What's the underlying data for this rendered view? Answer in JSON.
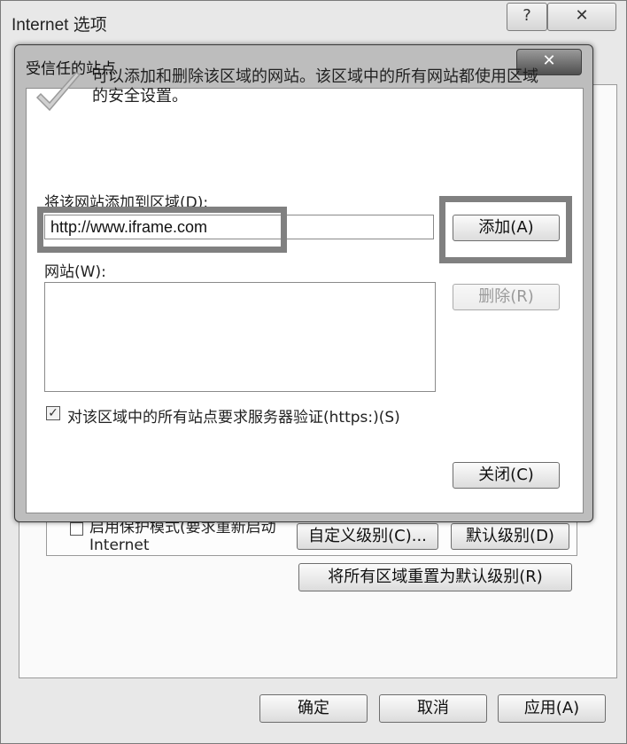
{
  "outer_window": {
    "title": "Internet 选项",
    "help_icon": "?",
    "close_icon": "✕",
    "protected_mode_label": "启用保护模式(要求重新启动 Internet",
    "custom_level_button": "自定义级别(C)...",
    "default_level_button": "默认级别(D)",
    "reset_all_button": "将所有区域重置为默认级别(R)",
    "ok_button": "确定",
    "cancel_button": "取消",
    "apply_button": "应用(A)"
  },
  "dialog": {
    "title": "受信任的站点",
    "close_icon": "✕",
    "description": "可以添加和删除该区域的网站。该区域中的所有网站都使用区域的安全设置。",
    "add_label": "将该网站添加到区域(D):",
    "url_value": "http://www.iframe.com",
    "add_button": "添加(A)",
    "websites_label": "网站(W):",
    "websites": [],
    "remove_button": "删除(R)",
    "https_checkbox_label": "对该区域中的所有站点要求服务器验证(https:)(S)",
    "https_checked": true,
    "close_button": "关闭(C)"
  }
}
